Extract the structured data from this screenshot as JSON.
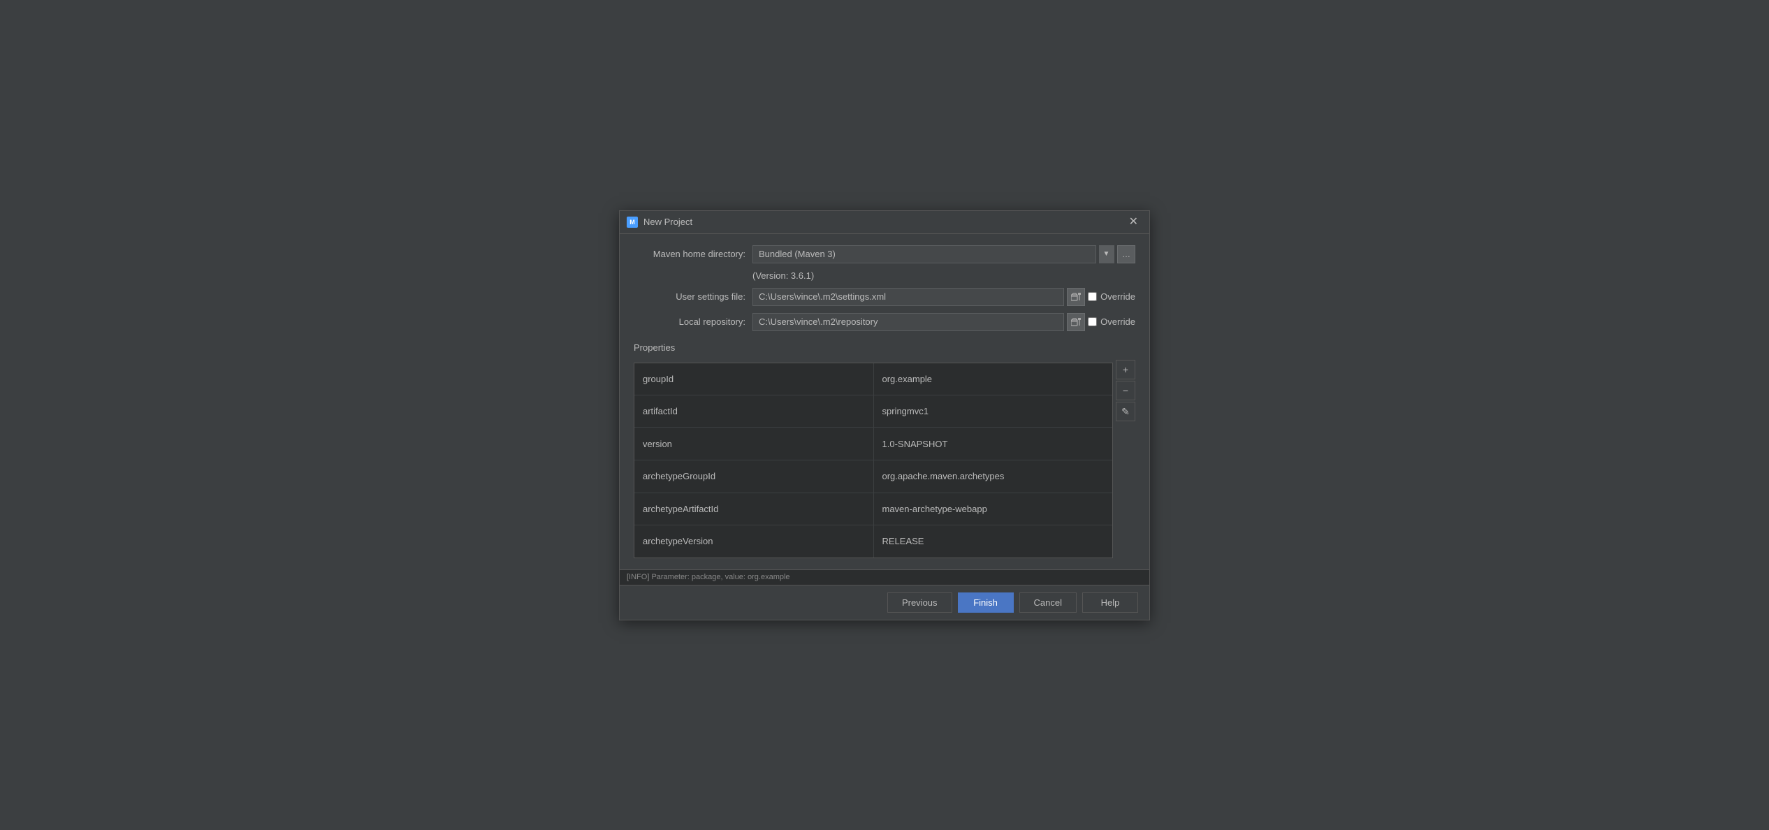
{
  "dialog": {
    "title": "New Project",
    "icon_label": "M",
    "close_label": "✕"
  },
  "form": {
    "maven_home_label": "Maven home directory:",
    "maven_home_underline_char": "h",
    "maven_home_value": "Bundled (Maven 3)",
    "maven_version_text": "(Version: 3.6.1)",
    "user_settings_label": "User settings file:",
    "user_settings_underline_char": "s",
    "user_settings_value": "C:\\Users\\vince\\.m2\\settings.xml",
    "user_settings_override": "Override",
    "local_repo_label": "Local repository:",
    "local_repo_underline_char": "r",
    "local_repo_value": "C:\\Users\\vince\\.m2\\repository",
    "local_repo_override": "Override",
    "properties_title": "Properties"
  },
  "properties": {
    "rows": [
      {
        "key": "groupId",
        "value": "org.example"
      },
      {
        "key": "artifactId",
        "value": "springmvc1"
      },
      {
        "key": "version",
        "value": "1.0-SNAPSHOT"
      },
      {
        "key": "archetypeGroupId",
        "value": "org.apache.maven.archetypes"
      },
      {
        "key": "archetypeArtifactId",
        "value": "maven-archetype-webapp"
      },
      {
        "key": "archetypeVersion",
        "value": "RELEASE"
      }
    ],
    "add_btn": "+",
    "remove_btn": "−",
    "edit_btn": "✎"
  },
  "footer": {
    "previous_label": "Previous",
    "previous_underline": "P",
    "finish_label": "Finish",
    "finish_underline": "F",
    "cancel_label": "Cancel",
    "help_label": "Help"
  },
  "bottom_log": "[INFO] Parameter: package, value: org.example"
}
